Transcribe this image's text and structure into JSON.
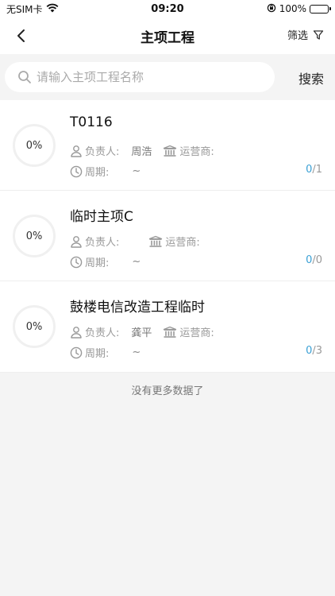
{
  "status_bar": {
    "carrier": "无SIM卡",
    "time": "09:20",
    "battery": "100%"
  },
  "nav": {
    "title": "主项工程",
    "filter_label": "筛选"
  },
  "search": {
    "placeholder": "请输入主项工程名称",
    "value": "",
    "button_label": "搜索"
  },
  "labels": {
    "owner": "负责人:",
    "operator": "运营商:",
    "period": "周期:"
  },
  "projects": [
    {
      "progress": "0%",
      "name": "T0116",
      "owner": "周浩",
      "operator": "",
      "period": "~",
      "done": "0",
      "total": "/1"
    },
    {
      "progress": "0%",
      "name": "临时主项C",
      "owner": "",
      "operator": "",
      "period": "~",
      "done": "0",
      "total": "/0"
    },
    {
      "progress": "0%",
      "name": "鼓楼电信改造工程临时",
      "owner": "龚平",
      "operator": "",
      "period": "~",
      "done": "0",
      "total": "/3"
    }
  ],
  "footer": {
    "no_more": "没有更多数据了"
  },
  "colors": {
    "accent": "#3aa0d5",
    "background": "#f4f4f4"
  }
}
